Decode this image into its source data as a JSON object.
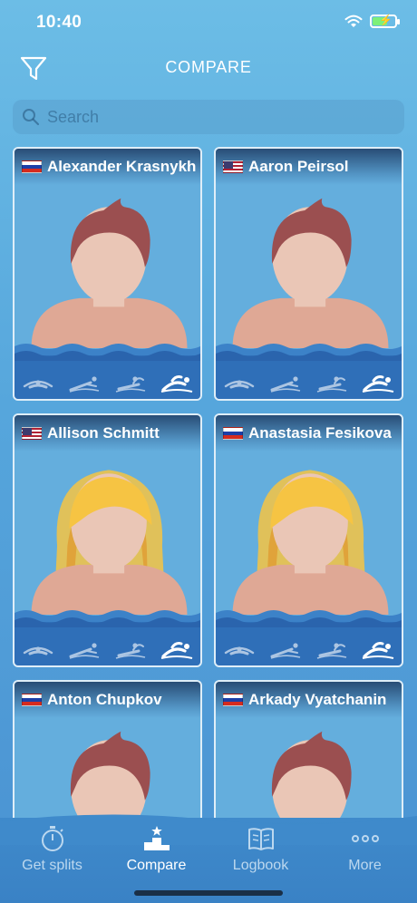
{
  "status": {
    "time": "10:40"
  },
  "header": {
    "title": "COMPARE",
    "filter_icon": "filter-icon"
  },
  "search": {
    "placeholder": "Search",
    "value": ""
  },
  "swimmers": [
    {
      "name": "Alexander Krasnykh",
      "flag": "ru",
      "hair": "short",
      "hair_color": "#9b4f50"
    },
    {
      "name": "Aaron Peirsol",
      "flag": "us",
      "hair": "short",
      "hair_color": "#9b4f50"
    },
    {
      "name": "Allison Schmitt",
      "flag": "us",
      "hair": "long",
      "hair_color": "#f6c443"
    },
    {
      "name": "Anastasia Fesikova",
      "flag": "ru",
      "hair": "long",
      "hair_color": "#f6c443"
    },
    {
      "name": "Anton Chupkov",
      "flag": "ru",
      "hair": "short",
      "hair_color": "#9b4f50"
    },
    {
      "name": "Arkady Vyatchanin",
      "flag": "ru",
      "hair": "short",
      "hair_color": "#9b4f50"
    }
  ],
  "stroke_icons": [
    "butterfly-icon",
    "breaststroke-icon",
    "backstroke-icon",
    "freestyle-icon"
  ],
  "tabs": [
    {
      "label": "Get splits",
      "icon": "stopwatch-icon",
      "active": false
    },
    {
      "label": "Compare",
      "icon": "podium-icon",
      "active": true
    },
    {
      "label": "Logbook",
      "icon": "book-icon",
      "active": false
    },
    {
      "label": "More",
      "icon": "more-dots-icon",
      "active": false
    }
  ],
  "colors": {
    "accent": "#4a92d2",
    "water": "#2f6fb8",
    "skin": "#eac6b6",
    "shoulders": "#dfa895"
  }
}
